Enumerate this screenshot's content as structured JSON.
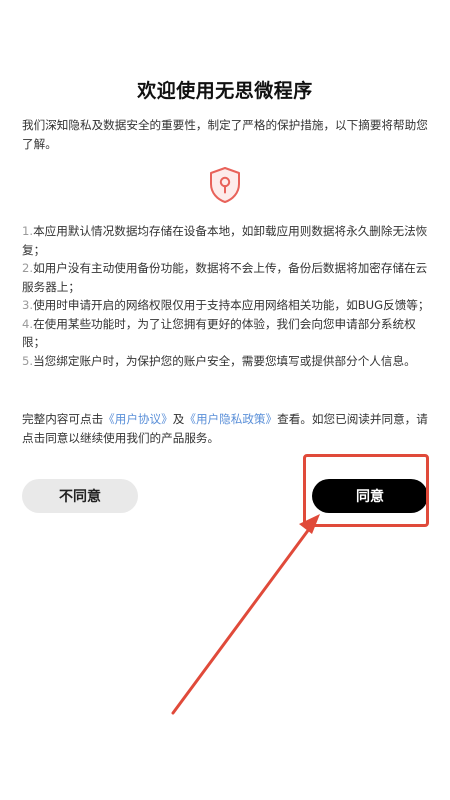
{
  "dialog": {
    "title": "欢迎使用无思微程序",
    "intro": "我们深知隐私及数据安全的重要性，制定了严格的保护措施，以下摘要将帮助您了解。",
    "terms": [
      {
        "num": "1.",
        "text": "本应用默认情况数据均存储在设备本地，如卸载应用则数据将永久删除无法恢复；"
      },
      {
        "num": "2.",
        "text": "如用户没有主动使用备份功能，数据将不会上传，备份后数据将加密存储在云服务器上；"
      },
      {
        "num": "3.",
        "text": "使用时申请开启的网络权限仅用于支持本应用网络相关功能，如BUG反馈等；"
      },
      {
        "num": "4.",
        "text": "在使用某些功能时，为了让您拥有更好的体验，我们会向您申请部分系统权限；"
      },
      {
        "num": "5.",
        "text": "当您绑定账户时，为保护您的账户安全，需要您填写或提供部分个人信息。"
      }
    ],
    "summary_prefix": "完整内容可点击",
    "user_agreement_link": "《用户协议》",
    "summary_and": "及",
    "privacy_policy_link": "《用户隐私政策》",
    "summary_suffix": "查看。如您已阅读并同意，请点击同意以继续使用我们的产品服务。",
    "disagree_label": "不同意",
    "agree_label": "同意"
  },
  "colors": {
    "accent_red": "#e04a3a",
    "shield_red": "#e8625a",
    "link_blue": "#5a8fd8",
    "agree_bg": "#000000",
    "disagree_bg": "#e9e9e9"
  },
  "icons": {
    "privacy": "shield-keyhole-icon"
  }
}
